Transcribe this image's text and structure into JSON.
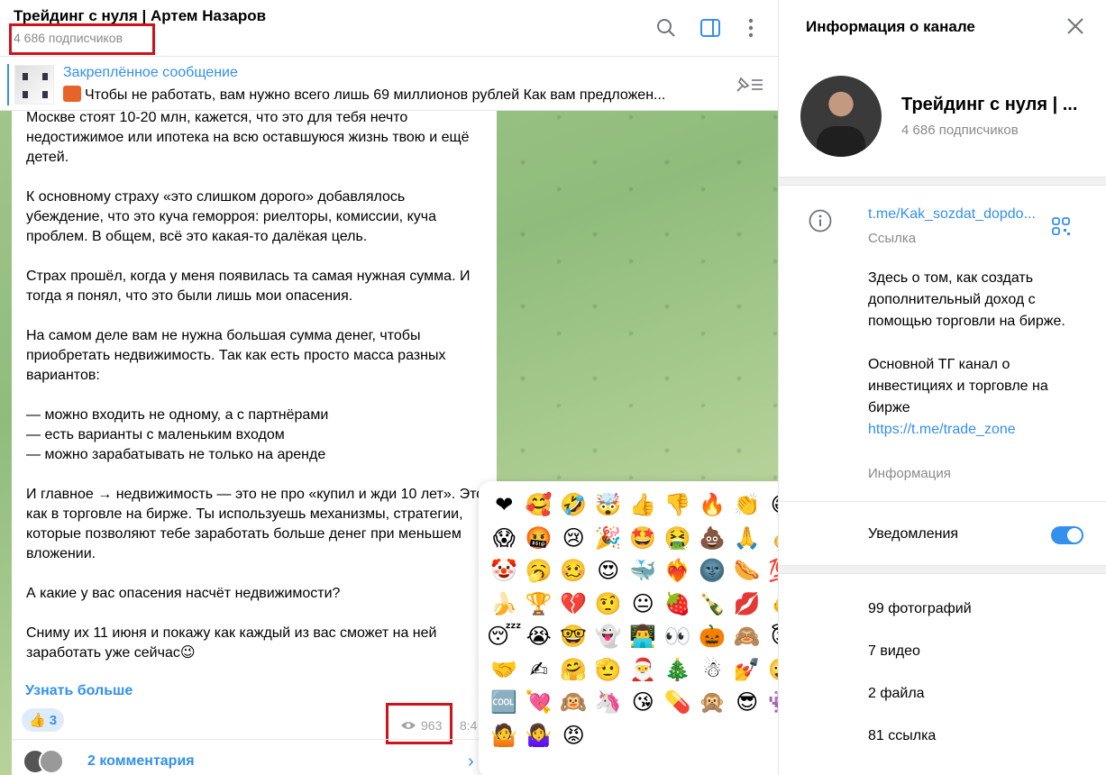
{
  "channel": {
    "title": "Трейдинг с нуля | Артем Назаров",
    "subscribers": "4 686 подписчиков"
  },
  "pinned": {
    "title": "Закреплённое сообщение",
    "text": "Чтобы не работать, вам нужно всего лишь 69 миллионов рублей   Как вам предложен..."
  },
  "message": {
    "paragraphs": [
      "Москве стоят 10-20 млн, кажется, что это для тебя нечто недостижимое или ипотека на всю оставшуюся жизнь твою и ещё детей.",
      "К основному страху «это слишком дорого» добавлялось убеждение, что это куча геморроя: риелторы, комиссии, куча проблем. В общем, всё это какая-то далёкая цель.",
      "Страх прошёл, когда у меня появилась та самая нужная сумма. И тогда я понял, что это были лишь мои опасения.",
      "На самом деле вам не нужна большая сумма денег, чтобы приобретать недвижимость. Так как есть просто масса разных вариантов:"
    ],
    "list": [
      "— можно входить не одному, а с партнёрами",
      "— есть варианты с маленьким входом",
      "— можно зарабатывать не только на аренде"
    ],
    "paragraphs2": [
      "И главное → недвижимость — это не про «купил и жди 10 лет». Это как в торговле на бирже. Ты используешь механизмы, стратегии, которые позволяют тебе заработать больше денег при меньшем вложении.",
      "А какие у вас опасения насчёт недвижимости?",
      "Сниму их 11 июня и покажу как каждый из вас сможет на ней заработать уже сейчас😉"
    ],
    "more_link": "Узнать больше",
    "reaction_emoji": "👍",
    "reaction_count": "3",
    "views": "963",
    "time": "8:4",
    "comments": "2 комментария"
  },
  "emoji_panel": {
    "emojis": [
      "❤",
      "🥰",
      "🤣",
      "🤯",
      "👍",
      "👎",
      "🔥",
      "👏",
      "😁",
      "🤔",
      "😱",
      "🤬",
      "😢",
      "🎉",
      "🤩",
      "🤮",
      "💩",
      "🙏",
      "👌",
      "🕊",
      "🤡",
      "🥱",
      "🥴",
      "😍",
      "🐳",
      "❤‍🔥",
      "🌚",
      "🌭",
      "💯",
      "⚡",
      "🍌",
      "🏆",
      "💔",
      "🤨",
      "😐",
      "🍓",
      "🍾",
      "💋",
      "🖕",
      "😈",
      "😴",
      "😭",
      "🤓",
      "👻",
      "👨‍💻",
      "👀",
      "🎃",
      "🙈",
      "😇",
      "😨",
      "🤝",
      "✍",
      "🤗",
      "🫡",
      "🎅",
      "🎄",
      "☃",
      "💅",
      "🤪",
      "🗿",
      "🆒",
      "💘",
      "🙉",
      "🦄",
      "😘",
      "💊",
      "🙊",
      "😎",
      "👾",
      "🤷‍♂",
      "🤷",
      "🤷‍♀",
      "😡"
    ]
  },
  "info": {
    "header": "Информация о канале",
    "name": "Трейдинг с нуля | ...",
    "subscribers": "4 686 подписчиков",
    "link": "t.me/Kak_sozdat_dopdo...",
    "link_label": "Ссылка",
    "desc1": "Здесь о том, как создать дополнительный доход с помощью торговли на бирже.",
    "desc2": "Основной ТГ канал о инвестициях и торговле на бирже",
    "desc_link": "https://t.me/trade_zone",
    "desc_label": "Информация",
    "notifications": "Уведомления",
    "notifications_on": true,
    "media": [
      "99 фотографий",
      "7 видео",
      "2 файла",
      "81 ссылка"
    ]
  },
  "colors": {
    "accent": "#3390ec",
    "highlight": "#d0121b"
  }
}
